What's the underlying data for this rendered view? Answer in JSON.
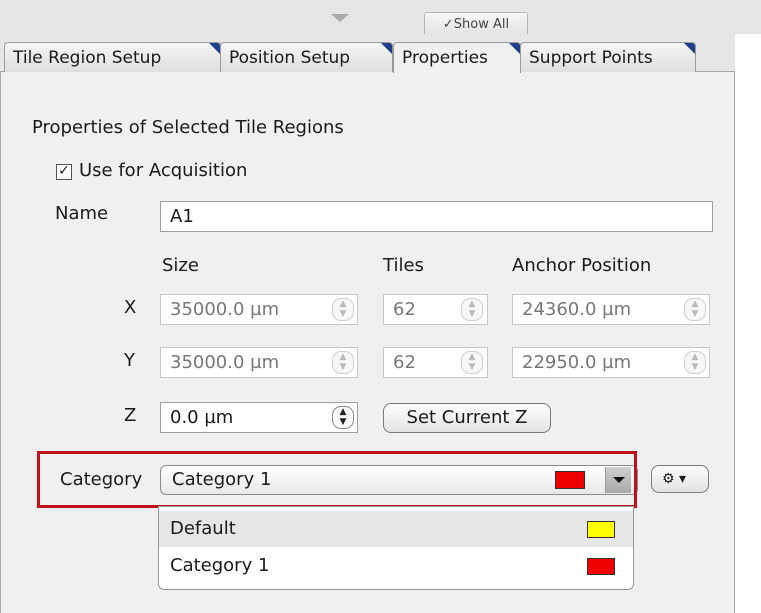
{
  "toolbar": {
    "show_all": "✓Show All"
  },
  "tabs": [
    {
      "label": "Tile Region Setup"
    },
    {
      "label": "Position Setup"
    },
    {
      "label": "Properties"
    },
    {
      "label": "Support Points"
    }
  ],
  "properties": {
    "section_title": "Properties of Selected Tile Regions",
    "use_for_acquisition": {
      "label": "Use for Acquisition",
      "checked": true
    },
    "name_label": "Name",
    "name_value": "A1",
    "headers": {
      "size": "Size",
      "tiles": "Tiles",
      "anchor": "Anchor Position"
    },
    "rows": [
      {
        "axis": "X",
        "size": "35000.0 µm",
        "tiles": "62",
        "anchor": "24360.0 µm"
      },
      {
        "axis": "Y",
        "size": "35000.0 µm",
        "tiles": "62",
        "anchor": "22950.0 µm"
      }
    ],
    "z": {
      "axis": "Z",
      "value": "0.0 µm",
      "button": "Set Current Z"
    },
    "category": {
      "label": "Category",
      "selected": "Category 1",
      "selected_color": "#ee0000",
      "options": [
        {
          "label": "Default",
          "color": "#ffff00"
        },
        {
          "label": "Category 1",
          "color": "#ee0000"
        }
      ]
    }
  }
}
